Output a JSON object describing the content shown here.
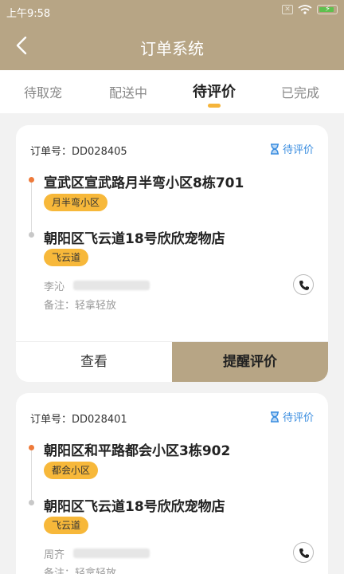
{
  "status_bar": {
    "time": "上午9:58",
    "sim_icon": "sim-x-icon",
    "wifi_icon": "wifi-icon",
    "battery_icon": "battery-charging-icon"
  },
  "nav": {
    "title": "订单系统",
    "back_icon": "back-chevron-icon"
  },
  "tabs": [
    {
      "label": "待取宠",
      "active": false
    },
    {
      "label": "配送中",
      "active": false
    },
    {
      "label": "待评价",
      "active": true
    },
    {
      "label": "已完成",
      "active": false
    }
  ],
  "colors": {
    "brand": "#b7a585",
    "accent_orange": "#f7b83a",
    "status_blue": "#3a8de0",
    "from_dot": "#ee7a3a"
  },
  "orders": [
    {
      "order_no": "订单号：DD028405",
      "status": "待评价",
      "from_address": "宣武区宣武路月半弯小区8栋701",
      "from_area": "月半弯小区",
      "to_address": "朝阳区飞云道18号欣欣宠物店",
      "to_area": "飞云道",
      "contact_name": "李沁",
      "note": "备注：轻拿轻放",
      "actions": {
        "view": "查看",
        "remind": "提醒评价"
      }
    },
    {
      "order_no": "订单号：DD028401",
      "status": "待评价",
      "from_address": "朝阳区和平路都会小区3栋902",
      "from_area": "都会小区",
      "to_address": "朝阳区飞云道18号欣欣宠物店",
      "to_area": "飞云道",
      "contact_name": "周齐",
      "note": "备注：轻拿轻放"
    }
  ]
}
